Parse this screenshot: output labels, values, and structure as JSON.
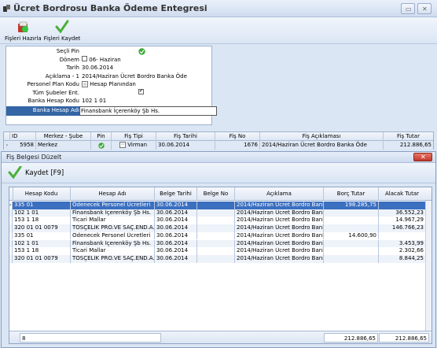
{
  "window": {
    "title": "Ücret Bordrosu Banka Ödeme Entegresi"
  },
  "toolbar": {
    "prepare_label": "Fişleri Hazırla",
    "save_label": "Fişleri Kaydet"
  },
  "form": {
    "rows": [
      {
        "label": "Seçli Pin",
        "value": ""
      },
      {
        "label": "Dönem",
        "value": "06- Haziran"
      },
      {
        "label": "Tarih",
        "value": "30.06.2014"
      },
      {
        "label": "Açıklama - 1",
        "value": "2014/Haziran Ücret Bordro Banka Öde"
      },
      {
        "label": "Personel Plan Kodu",
        "value": "Hesap Planından"
      },
      {
        "label": "Tüm Şubeler Ent.",
        "value": ""
      },
      {
        "label": "Banka Hesap Kodu",
        "value": "102 1 01"
      },
      {
        "label": "Banka Hesap Adı",
        "value": "Finansbank İçerenköy Şb Hs."
      }
    ]
  },
  "top_grid": {
    "columns": [
      "ID",
      "Merkez - Şube",
      "Pin",
      "Fiş Tipi",
      "Fiş Tarihi",
      "Fiş No",
      "Fiş Açıklaması",
      "Fiş Tutar"
    ],
    "row": {
      "id": "5958",
      "merkez": "Merkez",
      "pin": "",
      "tip": "Virman",
      "tarih": "30.06.2014",
      "no": "1676",
      "aciklama": "2014/Haziran Ücret Bordro Banka Öde",
      "tutar": "212.886,65"
    }
  },
  "dialog": {
    "title": "Fiş Belgesi Düzelt",
    "save_label": "Kaydet [F9]",
    "columns": [
      "Hesap Kodu",
      "Hesap Adı",
      "Belge Tarihi",
      "Belge No",
      "Açıklama",
      "Borç Tutar",
      "Alacak Tutar"
    ],
    "rows": [
      {
        "kod": "335 01",
        "ad": "Ödenecek Personel Ücretleri",
        "tarih": "30.06.2014",
        "no": "",
        "aciklama": "2014/Haziran Ücret Bordro Banka",
        "borc": "198.285,75",
        "alacak": ""
      },
      {
        "kod": "102 1 01",
        "ad": "Finansbank İçerenköy Şb Hs.",
        "tarih": "30.06.2014",
        "no": "",
        "aciklama": "2014/Haziran Ücret Bordro Banka",
        "borc": "",
        "alacak": "36.552,23"
      },
      {
        "kod": "153 1 18",
        "ad": "Ticari Mallar",
        "tarih": "30.06.2014",
        "no": "",
        "aciklama": "2014/Haziran Ücret Bordro Banka",
        "borc": "",
        "alacak": "14.967,29"
      },
      {
        "kod": "320 01 01 0079",
        "ad": "TOSÇELİK PRO.VE SAÇ.END.A.Ş",
        "tarih": "30.06.2014",
        "no": "",
        "aciklama": "2014/Haziran Ücret Bordro Banka",
        "borc": "",
        "alacak": "146.766,23"
      },
      {
        "kod": "335 01",
        "ad": "Ödenecek Personel Ücretleri",
        "tarih": "30.06.2014",
        "no": "",
        "aciklama": "2014/Haziran Ücret Bordro Banka",
        "borc": "14.600,90",
        "alacak": ""
      },
      {
        "kod": "102 1 01",
        "ad": "Finansbank İçerenköy Şb Hs.",
        "tarih": "30.06.2014",
        "no": "",
        "aciklama": "2014/Haziran Ücret Bordro Banka",
        "borc": "",
        "alacak": "3.453,99"
      },
      {
        "kod": "153 1 18",
        "ad": "Ticari Mallar",
        "tarih": "30.06.2014",
        "no": "",
        "aciklama": "2014/Haziran Ücret Bordro Banka",
        "borc": "",
        "alacak": "2.302,66"
      },
      {
        "kod": "320 01 01 0079",
        "ad": "TOSÇELİK PRO.VE SAÇ.END.A.Ş",
        "tarih": "30.06.2014",
        "no": "",
        "aciklama": "2014/Haziran Ücret Bordro Banka",
        "borc": "",
        "alacak": "8.844,25"
      }
    ],
    "footer": {
      "count": "8",
      "borc_total": "212.886,65",
      "alacak_total": "212.886,65"
    }
  }
}
